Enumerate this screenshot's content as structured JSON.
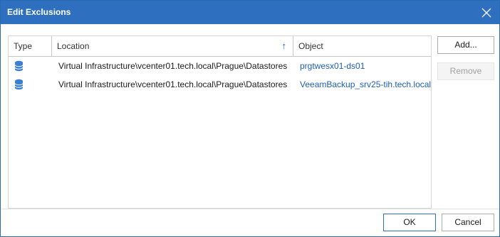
{
  "window": {
    "title": "Edit Exclusions"
  },
  "grid": {
    "columns": {
      "type": "Type",
      "location": "Location",
      "object": "Object"
    },
    "sort_indicator": "↑",
    "rows": [
      {
        "type_icon": "database-icon",
        "location": "Virtual Infrastructure\\vcenter01.tech.local\\Prague\\Datastores",
        "object": "prgtwesx01-ds01"
      },
      {
        "type_icon": "database-icon",
        "location": "Virtual Infrastructure\\vcenter01.tech.local\\Prague\\Datastores",
        "object": "VeeamBackup_srv25-tih.tech.local"
      }
    ]
  },
  "buttons": {
    "add": "Add...",
    "remove": "Remove",
    "ok": "OK",
    "cancel": "Cancel"
  },
  "colors": {
    "titlebar": "#2e6fbf",
    "link": "#1e5fb4",
    "icon": "#3a7fd0"
  }
}
